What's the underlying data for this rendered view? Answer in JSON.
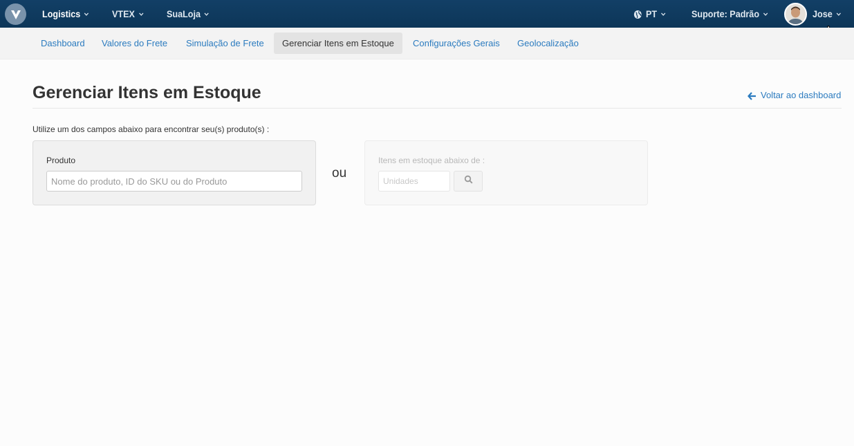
{
  "topbar": {
    "logo_icon": "vtex-logo-icon",
    "menus": [
      {
        "label": "Logistics",
        "active": true
      },
      {
        "label": "VTEX",
        "active": false
      },
      {
        "label": "SuaLoja",
        "active": false
      }
    ],
    "language": "PT",
    "support": "Suporte: Padrão",
    "user": "Jose",
    "background_color": "#0f3a5f"
  },
  "subnav": {
    "items": [
      {
        "label": "Dashboard",
        "active": false
      },
      {
        "label": "Valores do Frete",
        "active": false
      },
      {
        "label": "Simulação de Frete",
        "active": false
      },
      {
        "label": "Gerenciar Itens em Estoque",
        "active": true
      },
      {
        "label": "Configurações Gerais",
        "active": false
      },
      {
        "label": "Geolocalização",
        "active": false
      }
    ]
  },
  "main": {
    "title": "Gerenciar Itens em Estoque",
    "back_link": "Voltar ao dashboard",
    "instructions": "Utilize um dos campos abaixo para encontrar seu(s) produto(s) :",
    "product_search": {
      "label": "Produto",
      "placeholder": "Nome do produto, ID do SKU ou do Produto",
      "value": ""
    },
    "separator": "ou",
    "stock_search": {
      "label": "Itens em estoque abaixo de :",
      "placeholder": "Unidades",
      "value": "",
      "button_icon": "search-icon"
    },
    "link_color": "#2b7bbf"
  }
}
